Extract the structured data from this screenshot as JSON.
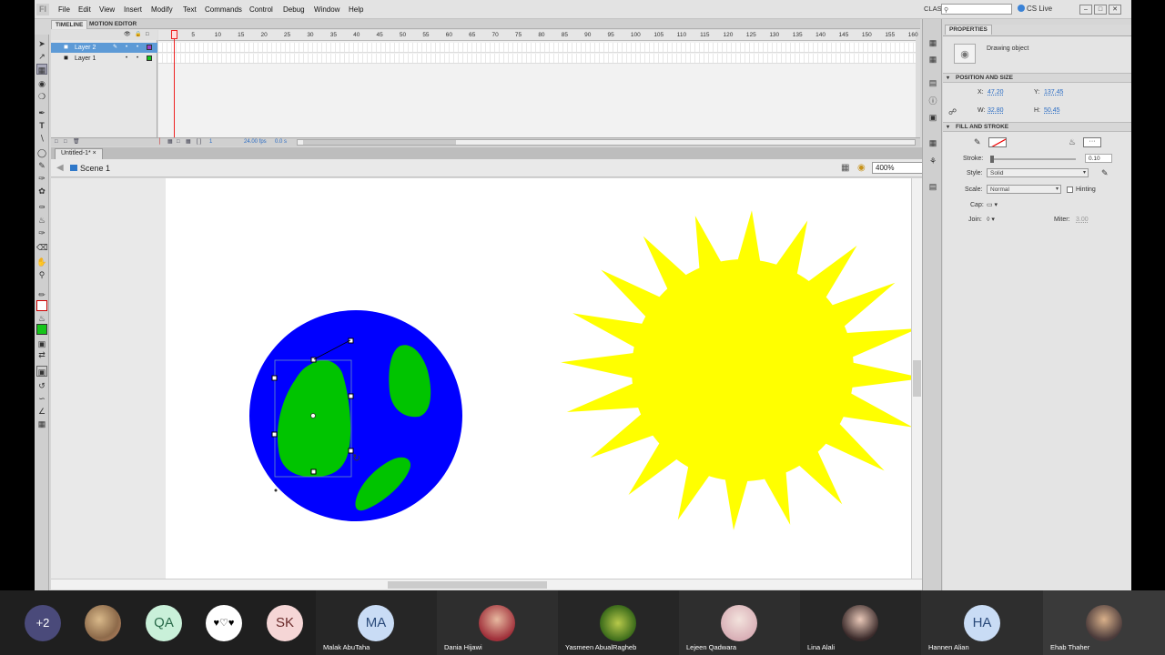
{
  "app": {
    "menu": [
      "File",
      "Edit",
      "View",
      "Insert",
      "Modify",
      "Text",
      "Commands",
      "Control",
      "Debug",
      "Window",
      "Help"
    ],
    "workspace": "CLASSIC ▾",
    "search_placeholder": "",
    "cs_live": "CS Live",
    "window_buttons": [
      "–",
      "□",
      "✕"
    ]
  },
  "timeline": {
    "tabs": [
      "TIMELINE",
      "MOTION EDITOR"
    ],
    "layers": [
      {
        "name": "Layer 2",
        "color": "#9b3fc9",
        "selected": true
      },
      {
        "name": "Layer 1",
        "color": "#16c51a",
        "selected": false
      }
    ],
    "frame_numbers": [
      "1",
      "5",
      "10",
      "15",
      "20",
      "25",
      "30",
      "35",
      "40",
      "45",
      "50",
      "55",
      "60",
      "65",
      "70",
      "75",
      "80",
      "85",
      "90",
      "95",
      "100",
      "105",
      "110",
      "115",
      "120",
      "125",
      "130",
      "135",
      "140",
      "145",
      "150",
      "155",
      "160"
    ],
    "current_frame": "1",
    "fps": "24.00 fps",
    "time": "0.0 s"
  },
  "document": {
    "tab": "Untitled-1*",
    "scene": "Scene 1",
    "zoom": "400%"
  },
  "stage_art": {
    "earth_ocean_color": "#0000ff",
    "land_color": "#00c400",
    "sun_color": "#ffff00"
  },
  "properties": {
    "tab": "PROPERTIES",
    "object_type": "Drawing object",
    "position_size_header": "POSITION AND SIZE",
    "x_label": "X:",
    "x_value": "47.20",
    "y_label": "Y:",
    "y_value": "137.45",
    "w_label": "W:",
    "w_value": "32.80",
    "h_label": "H:",
    "h_value": "50.45",
    "fill_stroke_header": "FILL AND STROKE",
    "stroke_label": "Stroke:",
    "stroke_value": "0.10",
    "style_label": "Style:",
    "style_value": "Solid",
    "scale_label": "Scale:",
    "scale_value": "Normal",
    "hinting_label": "Hinting",
    "cap_label": "Cap:",
    "join_label": "Join:",
    "miter_label": "Miter:",
    "miter_value": "3.00"
  },
  "call": {
    "overflow": "+2",
    "participants": [
      {
        "initials": "",
        "name": ""
      },
      {
        "initials": "QA",
        "name": ""
      },
      {
        "initials": "",
        "name": ""
      },
      {
        "initials": "SK",
        "name": ""
      },
      {
        "initials": "MA",
        "name": "Malak AbuTaha"
      },
      {
        "initials": "",
        "name": "Dania Hijawi"
      },
      {
        "initials": "",
        "name": "Yasmeen AbualRagheb"
      },
      {
        "initials": "",
        "name": "Lejeen Qadwara"
      },
      {
        "initials": "",
        "name": "Lina Alali"
      },
      {
        "initials": "HA",
        "name": "Hannen Alian"
      },
      {
        "initials": "",
        "name": "Ehab Thaher"
      }
    ]
  }
}
